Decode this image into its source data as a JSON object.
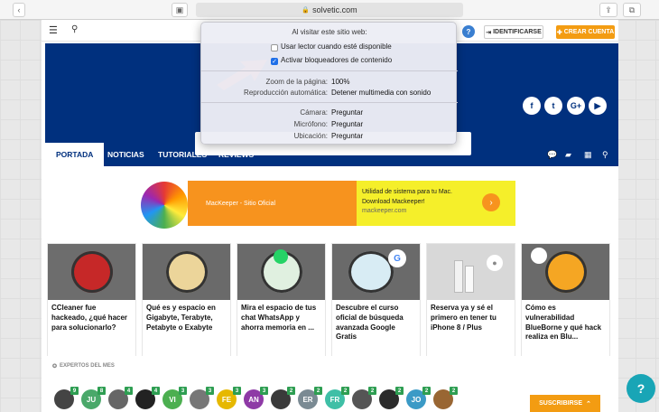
{
  "browser": {
    "url": "solvetic.com"
  },
  "header": {
    "signin": "IDENTIFICARSE",
    "create": "CREAR CUENTA",
    "help": "?"
  },
  "nav": {
    "items": [
      "PORTADA",
      "NOTICIAS",
      "TUTORIALES",
      "REVIEWS"
    ]
  },
  "ad": {
    "left_text": "MacKeeper - Sitio Oficial",
    "line1": "Utilidad de sistema para tu Mac.",
    "line2": "Download Mackeeper!",
    "domain": "mackeeper.com"
  },
  "cards": [
    {
      "title": "CCleaner fue hackeado, ¿qué hacer para solucionarlo?"
    },
    {
      "title": "Qué es y espacio en Gigabyte, Terabyte, Petabyte o Exabyte"
    },
    {
      "title": "Mira el espacio de tus chat WhatsApp y ahorra memoria en ..."
    },
    {
      "title": "Descubre el curso oficial de búsqueda avanzada Google Gratis"
    },
    {
      "title": "Reserva ya y sé el primero en tener tu iPhone 8 / Plus"
    },
    {
      "title": "Cómo es vulnerabilidad BlueBorne y qué hack realiza en Blu..."
    }
  ],
  "experts": {
    "title": "EXPERTOS DEL MES",
    "avatars": [
      {
        "initials": "",
        "badge": "9",
        "color": "#444"
      },
      {
        "initials": "JU",
        "badge": "8",
        "color": "#4aa86a"
      },
      {
        "initials": "",
        "badge": "4",
        "color": "#666"
      },
      {
        "initials": "",
        "badge": "4",
        "color": "#222"
      },
      {
        "initials": "VI",
        "badge": "3",
        "color": "#4caf50"
      },
      {
        "initials": "",
        "badge": "3",
        "color": "#777"
      },
      {
        "initials": "FE",
        "badge": "3",
        "color": "#e6b800"
      },
      {
        "initials": "AN",
        "badge": "3",
        "color": "#8e3aa6"
      },
      {
        "initials": "",
        "badge": "2",
        "color": "#3a3a3a"
      },
      {
        "initials": "ER",
        "badge": "2",
        "color": "#7a8a93"
      },
      {
        "initials": "FR",
        "badge": "2",
        "color": "#3fbfa6"
      },
      {
        "initials": "",
        "badge": "2",
        "color": "#555"
      },
      {
        "initials": "",
        "badge": "2",
        "color": "#2b2b2b"
      },
      {
        "initials": "JO",
        "badge": "2",
        "color": "#3b9ac6"
      },
      {
        "initials": "",
        "badge": "2",
        "color": "#996633"
      }
    ]
  },
  "subscribe": {
    "label": "SUSCRIBIRSE"
  },
  "popup": {
    "title": "Al visitar este sitio web:",
    "option1": "Usar lector cuando esté disponible",
    "option2": "Activar bloqueadores de contenido",
    "zoom_label": "Zoom de la página:",
    "zoom_value": "100%",
    "autoplay_label": "Reproducción automática:",
    "autoplay_value": "Detener multimedia con sonido",
    "camera_label": "Cámara:",
    "camera_value": "Preguntar",
    "mic_label": "Micrófono:",
    "mic_value": "Preguntar",
    "location_label": "Ubicación:",
    "location_value": "Preguntar"
  }
}
